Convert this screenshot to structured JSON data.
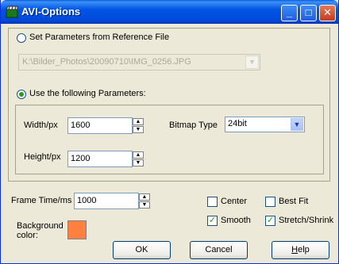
{
  "window": {
    "title": "AVI-Options",
    "minimize_glyph": "_",
    "maximize_glyph": "□",
    "close_glyph": "✕"
  },
  "reference": {
    "radio_label": "Set Parameters from Reference File",
    "selected": false,
    "file_path": "K:\\Bilder_Photos\\20090710\\IMG_0256.JPG"
  },
  "parameters": {
    "radio_label": "Use the following Parameters:",
    "selected": true,
    "width_label": "Width/px",
    "width_value": "1600",
    "height_label": "Height/px",
    "height_value": "1200",
    "bitmap_type_label": "Bitmap Type",
    "bitmap_type_value": "24bit"
  },
  "frame_time": {
    "label": "Frame Time/ms",
    "value": "1000"
  },
  "background": {
    "label_line1": "Background",
    "label_line2": "color:",
    "color": "#ff8040"
  },
  "options": {
    "center": {
      "label": "Center",
      "checked": false
    },
    "best_fit": {
      "label": "Best Fit",
      "checked": false
    },
    "smooth": {
      "label": "Smooth",
      "checked": true
    },
    "stretch_shrink": {
      "label": "Stretch/Shrink",
      "checked": true
    }
  },
  "buttons": {
    "ok": "OK",
    "cancel": "Cancel",
    "help_prefix": "H",
    "help_rest": "elp"
  },
  "icons": {
    "spin_up": "▲",
    "spin_down": "▼",
    "dropdown": "▼",
    "check": "✓"
  }
}
